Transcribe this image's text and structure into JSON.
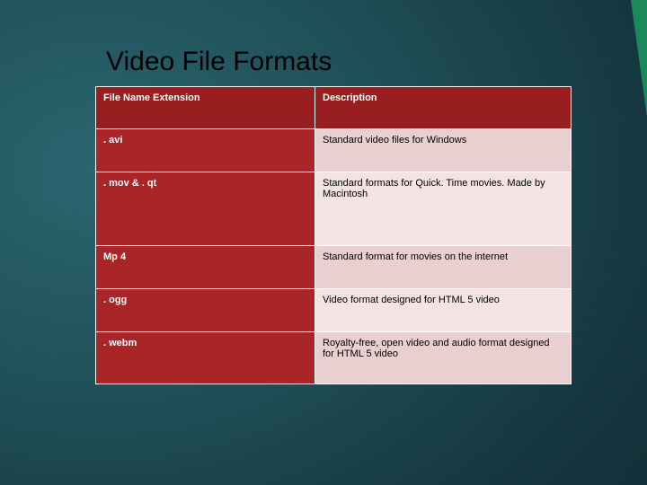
{
  "title": "Video File Formats",
  "headers": {
    "col1": "File Name Extension",
    "col2": "Description"
  },
  "rows": [
    {
      "ext": ". avi",
      "desc": "Standard video files for Windows"
    },
    {
      "ext": ". mov & . qt",
      "desc": "Standard formats for Quick. Time movies. Made by Macintosh"
    },
    {
      "ext": "Mp 4",
      "desc": "Standard format for movies on the internet"
    },
    {
      "ext": ". ogg",
      "desc": "Video format designed for HTML 5 video"
    },
    {
      "ext": ". webm",
      "desc": "Royalty-free, open video and audio format designed for HTML 5 video"
    }
  ],
  "chart_data": {
    "type": "table",
    "title": "Video File Formats",
    "columns": [
      "File Name Extension",
      "Description"
    ],
    "rows": [
      [
        ". avi",
        "Standard video files for Windows"
      ],
      [
        ". mov & . qt",
        "Standard formats for Quick. Time movies. Made by Macintosh"
      ],
      [
        "Mp 4",
        "Standard format for movies on the internet"
      ],
      [
        ". ogg",
        "Video format designed for HTML 5 video"
      ],
      [
        ". webm",
        "Royalty-free, open video and audio format designed for HTML 5 video"
      ]
    ]
  }
}
